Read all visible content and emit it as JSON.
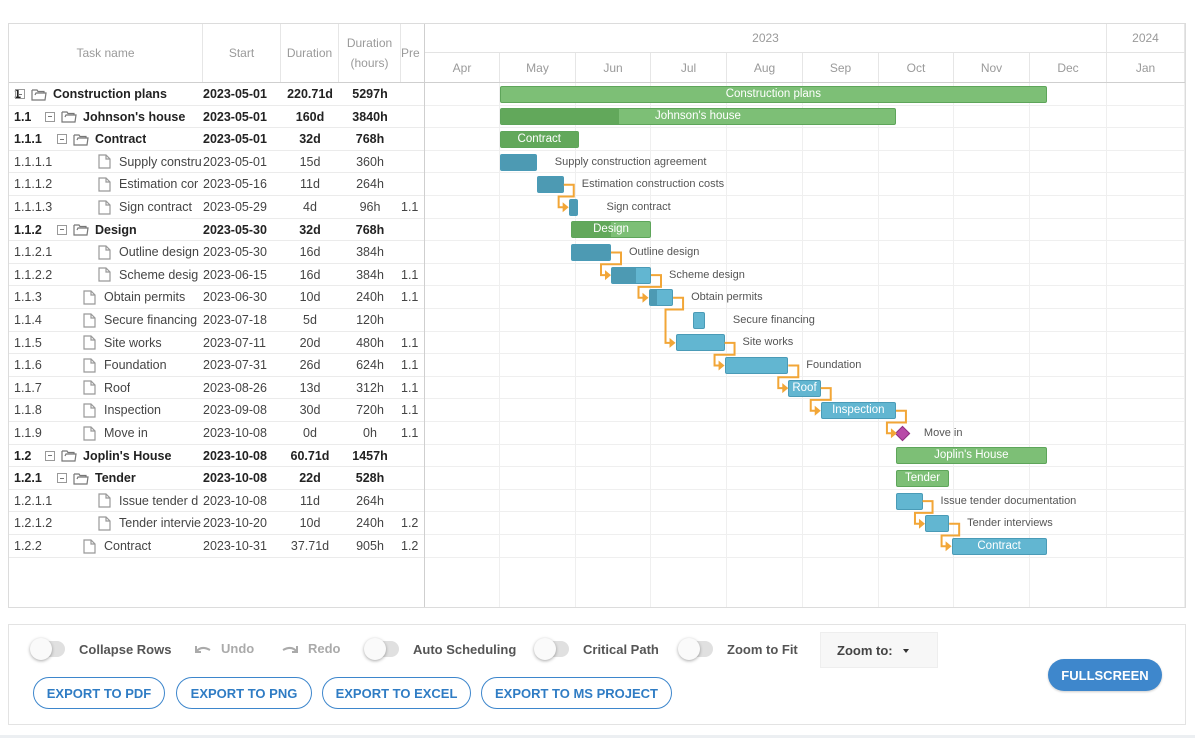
{
  "grid": {
    "columns": [
      {
        "key": "name",
        "label": "Task name"
      },
      {
        "key": "start",
        "label": "Start"
      },
      {
        "key": "duration",
        "label": "Duration"
      },
      {
        "key": "hours",
        "label": "Duration (hours)"
      },
      {
        "key": "pred",
        "label": "Pre"
      }
    ],
    "rows": [
      {
        "wbs": "1",
        "name": "Construction plans",
        "start": "2023-05-01",
        "duration": "220.71d",
        "hours": "5297h",
        "pred": "",
        "type": "project",
        "level": 0
      },
      {
        "wbs": "1.1",
        "name": "Johnson's house",
        "start": "2023-05-01",
        "duration": "160d",
        "hours": "3840h",
        "pred": "",
        "type": "project",
        "level": 1
      },
      {
        "wbs": "1.1.1",
        "name": "Contract",
        "start": "2023-05-01",
        "duration": "32d",
        "hours": "768h",
        "pred": "",
        "type": "project",
        "level": 2
      },
      {
        "wbs": "1.1.1.1",
        "name": "Supply constru",
        "start": "2023-05-01",
        "duration": "15d",
        "hours": "360h",
        "pred": "",
        "type": "task",
        "level": 3
      },
      {
        "wbs": "1.1.1.2",
        "name": "Estimation cor",
        "start": "2023-05-16",
        "duration": "11d",
        "hours": "264h",
        "pred": "",
        "type": "task",
        "level": 3
      },
      {
        "wbs": "1.1.1.3",
        "name": "Sign contract",
        "start": "2023-05-29",
        "duration": "4d",
        "hours": "96h",
        "pred": "1.1",
        "type": "task",
        "level": 3
      },
      {
        "wbs": "1.1.2",
        "name": "Design",
        "start": "2023-05-30",
        "duration": "32d",
        "hours": "768h",
        "pred": "",
        "type": "project",
        "level": 2
      },
      {
        "wbs": "1.1.2.1",
        "name": "Outline design",
        "start": "2023-05-30",
        "duration": "16d",
        "hours": "384h",
        "pred": "",
        "type": "task",
        "level": 3
      },
      {
        "wbs": "1.1.2.2",
        "name": "Scheme desig",
        "start": "2023-06-15",
        "duration": "16d",
        "hours": "384h",
        "pred": "1.1",
        "type": "task",
        "level": 3
      },
      {
        "wbs": "1.1.3",
        "name": "Obtain permits",
        "start": "2023-06-30",
        "duration": "10d",
        "hours": "240h",
        "pred": "1.1",
        "type": "task",
        "level": 2
      },
      {
        "wbs": "1.1.4",
        "name": "Secure financing",
        "start": "2023-07-18",
        "duration": "5d",
        "hours": "120h",
        "pred": "",
        "type": "task",
        "level": 2
      },
      {
        "wbs": "1.1.5",
        "name": "Site works",
        "start": "2023-07-11",
        "duration": "20d",
        "hours": "480h",
        "pred": "1.1",
        "type": "task",
        "level": 2
      },
      {
        "wbs": "1.1.6",
        "name": "Foundation",
        "start": "2023-07-31",
        "duration": "26d",
        "hours": "624h",
        "pred": "1.1",
        "type": "task",
        "level": 2
      },
      {
        "wbs": "1.1.7",
        "name": "Roof",
        "start": "2023-08-26",
        "duration": "13d",
        "hours": "312h",
        "pred": "1.1",
        "type": "task",
        "level": 2
      },
      {
        "wbs": "1.1.8",
        "name": "Inspection",
        "start": "2023-09-08",
        "duration": "30d",
        "hours": "720h",
        "pred": "1.1",
        "type": "task",
        "level": 2
      },
      {
        "wbs": "1.1.9",
        "name": "Move in",
        "start": "2023-10-08",
        "duration": "0d",
        "hours": "0h",
        "pred": "1.1",
        "type": "milestone",
        "level": 2
      },
      {
        "wbs": "1.2",
        "name": "Joplin's House",
        "start": "2023-10-08",
        "duration": "60.71d",
        "hours": "1457h",
        "pred": "",
        "type": "project",
        "level": 1
      },
      {
        "wbs": "1.2.1",
        "name": "Tender",
        "start": "2023-10-08",
        "duration": "22d",
        "hours": "528h",
        "pred": "",
        "type": "project",
        "level": 2
      },
      {
        "wbs": "1.2.1.1",
        "name": "Issue tender d",
        "start": "2023-10-08",
        "duration": "11d",
        "hours": "264h",
        "pred": "",
        "type": "task",
        "level": 3
      },
      {
        "wbs": "1.2.1.2",
        "name": "Tender intervie",
        "start": "2023-10-20",
        "duration": "10d",
        "hours": "240h",
        "pred": "1.2",
        "type": "task",
        "level": 3
      },
      {
        "wbs": "1.2.2",
        "name": "Contract",
        "start": "2023-10-31",
        "duration": "37.71d",
        "hours": "905h",
        "pred": "1.2",
        "type": "task",
        "level": 2
      }
    ]
  },
  "timeline": {
    "years": [
      {
        "label": "2023",
        "months": 9
      },
      {
        "label": "2024",
        "months": 1
      }
    ],
    "months": [
      "Apr",
      "May",
      "Jun",
      "Jul",
      "Aug",
      "Sep",
      "Oct",
      "Nov",
      "Dec",
      "Jan"
    ],
    "scale_start": "2023-04-01",
    "bars": [
      {
        "row": 0,
        "label": "Construction plans",
        "label_pos": "inside",
        "start": "2023-05-01",
        "days": 220.71,
        "progress": 0,
        "type": "project"
      },
      {
        "row": 1,
        "label": "Johnson's house",
        "label_pos": "inside",
        "start": "2023-05-01",
        "days": 160,
        "progress": 0.3,
        "type": "project"
      },
      {
        "row": 2,
        "label": "Contract",
        "label_pos": "inside",
        "start": "2023-05-01",
        "days": 32,
        "progress": 1,
        "type": "project"
      },
      {
        "row": 3,
        "label": "Supply construction agreement",
        "label_pos": "right",
        "start": "2023-05-01",
        "days": 15,
        "progress": 1,
        "type": "task"
      },
      {
        "row": 4,
        "label": "Estimation construction costs",
        "label_pos": "right",
        "start": "2023-05-16",
        "days": 11,
        "progress": 1,
        "type": "task"
      },
      {
        "row": 5,
        "label": "Sign contract",
        "label_pos": "right",
        "start": "2023-05-29",
        "days": 4,
        "progress": 1,
        "type": "task"
      },
      {
        "row": 6,
        "label": "Design",
        "label_pos": "inside",
        "start": "2023-05-30",
        "days": 32,
        "progress": 0.5,
        "type": "project"
      },
      {
        "row": 7,
        "label": "Outline design",
        "label_pos": "right",
        "start": "2023-05-30",
        "days": 16,
        "progress": 1,
        "type": "task"
      },
      {
        "row": 8,
        "label": "Scheme design",
        "label_pos": "right",
        "start": "2023-06-15",
        "days": 16,
        "progress": 0.62,
        "type": "task"
      },
      {
        "row": 9,
        "label": "Obtain permits",
        "label_pos": "right",
        "start": "2023-06-30",
        "days": 10,
        "progress": 0.35,
        "type": "task"
      },
      {
        "row": 10,
        "label": "Secure financing",
        "label_pos": "right",
        "start": "2023-07-18",
        "days": 5,
        "progress": 0,
        "type": "task"
      },
      {
        "row": 11,
        "label": "Site works",
        "label_pos": "right",
        "start": "2023-07-11",
        "days": 20,
        "progress": 0,
        "type": "task"
      },
      {
        "row": 12,
        "label": "Foundation",
        "label_pos": "right",
        "start": "2023-07-31",
        "days": 26,
        "progress": 0,
        "type": "task"
      },
      {
        "row": 13,
        "label": "Roof",
        "label_pos": "inside",
        "start": "2023-08-26",
        "days": 13,
        "progress": 0,
        "type": "task"
      },
      {
        "row": 14,
        "label": "Inspection",
        "label_pos": "inside",
        "start": "2023-09-08",
        "days": 30,
        "progress": 0,
        "type": "task"
      },
      {
        "row": 15,
        "label": "Move in",
        "label_pos": "right",
        "start": "2023-10-08",
        "days": 0,
        "progress": 0,
        "type": "milestone"
      },
      {
        "row": 16,
        "label": "Joplin's House",
        "label_pos": "inside",
        "start": "2023-10-08",
        "days": 60.71,
        "progress": 0,
        "type": "project"
      },
      {
        "row": 17,
        "label": "Tender",
        "label_pos": "inside",
        "start": "2023-10-08",
        "days": 22,
        "progress": 0,
        "type": "project"
      },
      {
        "row": 18,
        "label": "Issue tender documentation",
        "label_pos": "right",
        "start": "2023-10-08",
        "days": 11,
        "progress": 0,
        "type": "task"
      },
      {
        "row": 19,
        "label": "Tender interviews",
        "label_pos": "right",
        "start": "2023-10-20",
        "days": 10,
        "progress": 0,
        "type": "task"
      },
      {
        "row": 20,
        "label": "Contract",
        "label_pos": "inside",
        "start": "2023-10-31",
        "days": 37.71,
        "progress": 0,
        "type": "task"
      }
    ],
    "links": [
      [
        4,
        5
      ],
      [
        7,
        8
      ],
      [
        8,
        9
      ],
      [
        9,
        11
      ],
      [
        11,
        12
      ],
      [
        12,
        13
      ],
      [
        13,
        14
      ],
      [
        14,
        15
      ],
      [
        18,
        19
      ],
      [
        19,
        20
      ]
    ]
  },
  "colors": {
    "project_bar": "#7dbf76",
    "project_progress": "#62a85b",
    "task_bar": "#62b6d1",
    "task_progress": "#4d9ab3",
    "milestone": "#b84aa8",
    "link": "#f2a637",
    "accent": "#3e87cc"
  },
  "toolbar": {
    "collapse_rows": "Collapse Rows",
    "undo": "Undo",
    "redo": "Redo",
    "auto_scheduling": "Auto Scheduling",
    "critical_path": "Critical Path",
    "zoom_to_fit": "Zoom to Fit",
    "zoom_to": "Zoom to:",
    "export_pdf": "EXPORT TO PDF",
    "export_png": "EXPORT TO PNG",
    "export_excel": "EXPORT TO EXCEL",
    "export_msproject": "EXPORT TO MS PROJECT",
    "fullscreen": "FULLSCREEN",
    "toggles": {
      "collapse_rows": false,
      "auto_scheduling": false,
      "critical_path": false,
      "zoom_to_fit": false
    }
  }
}
